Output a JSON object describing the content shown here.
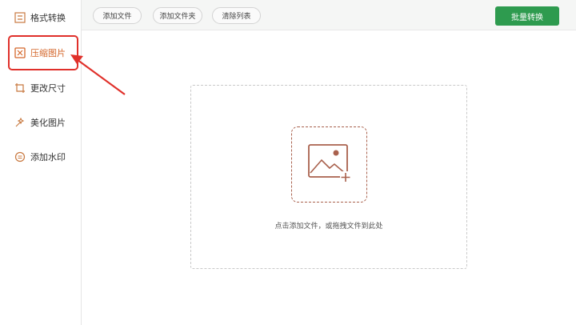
{
  "sidebar": {
    "items": [
      {
        "label": "格式转换",
        "icon": "format-convert-icon"
      },
      {
        "label": "压缩图片",
        "icon": "compress-image-icon",
        "active": true
      },
      {
        "label": "更改尺寸",
        "icon": "resize-icon"
      },
      {
        "label": "美化图片",
        "icon": "beautify-icon"
      },
      {
        "label": "添加水印",
        "icon": "watermark-icon"
      }
    ]
  },
  "toolbar": {
    "add_file": "添加文件",
    "add_folder": "添加文件夹",
    "clear_list": "清除列表",
    "batch_convert": "批量转换"
  },
  "dropzone": {
    "hint": "点击添加文件，或拖拽文件到此处"
  },
  "colors": {
    "accent": "#d4662a",
    "primary_button": "#2e9b4f",
    "annotation_red": "#e0302a"
  }
}
